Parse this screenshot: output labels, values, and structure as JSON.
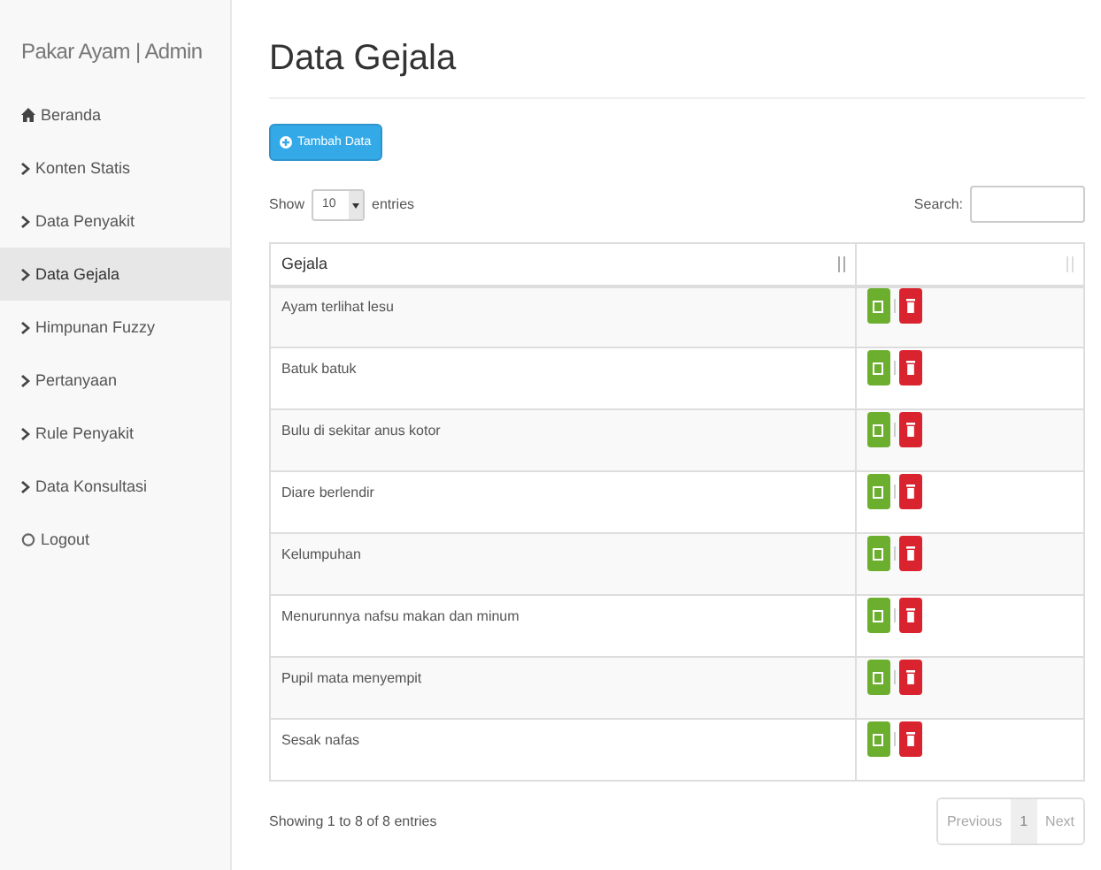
{
  "sidebar": {
    "brand": "Pakar Ayam | Admin",
    "items": [
      {
        "label": "Beranda",
        "kind": "home",
        "selected": false
      },
      {
        "label": "Konten Statis",
        "kind": "link",
        "selected": false
      },
      {
        "label": "Data Penyakit",
        "kind": "link",
        "selected": false
      },
      {
        "label": "Data Gejala",
        "kind": "link",
        "selected": true
      },
      {
        "label": "Himpunan Fuzzy",
        "kind": "link",
        "selected": false
      },
      {
        "label": "Pertanyaan",
        "kind": "link",
        "selected": false
      },
      {
        "label": "Rule Penyakit",
        "kind": "link",
        "selected": false
      },
      {
        "label": "Data Konsultasi",
        "kind": "link",
        "selected": false
      },
      {
        "label": "Logout",
        "kind": "logout",
        "selected": false
      }
    ]
  },
  "page_title": "Data Gejala",
  "add_button": "Tambah Data",
  "length": {
    "show": "Show",
    "value": "10",
    "entries": "entries"
  },
  "search": {
    "label": "Search:"
  },
  "table": {
    "columns": [
      "Gejala"
    ],
    "rows": [
      {
        "gejala": "Ayam terlihat lesu"
      },
      {
        "gejala": "Batuk batuk"
      },
      {
        "gejala": "Bulu di sekitar anus kotor"
      },
      {
        "gejala": "Diare berlendir"
      },
      {
        "gejala": "Kelumpuhan"
      },
      {
        "gejala": "Menurunnya nafsu makan dan minum"
      },
      {
        "gejala": "Pupil mata menyempit"
      },
      {
        "gejala": "Sesak nafas"
      }
    ]
  },
  "info": "Showing 1 to 8 of 8 entries",
  "pagination": [
    {
      "label": "Previous",
      "kind": "nav",
      "selected": false
    },
    {
      "label": "1",
      "kind": "page",
      "selected": true
    },
    {
      "label": "Next",
      "kind": "nav",
      "selected": false
    }
  ]
}
